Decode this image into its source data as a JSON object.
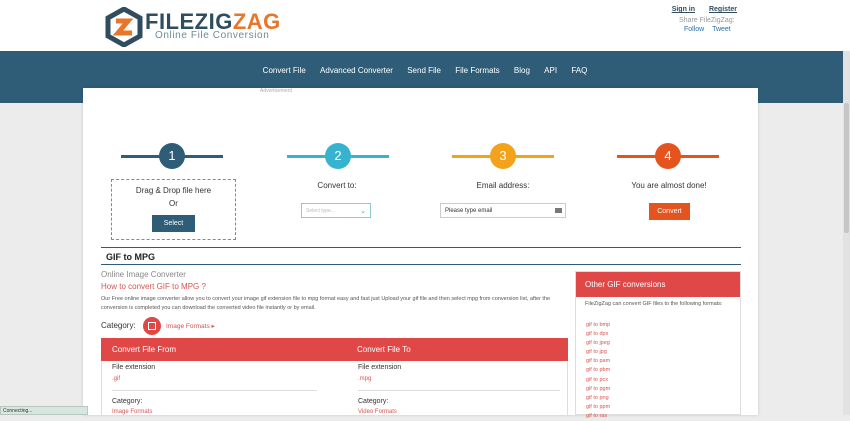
{
  "header": {
    "brand_main": "FILEZIG",
    "brand_accent": "ZAG",
    "tagline": "Online File Conversion",
    "sign_in": "Sign in",
    "register": "Register",
    "share_label": "Share FileZigZag:",
    "follow": "Follow",
    "tweet": "Tweet"
  },
  "nav": {
    "items": [
      "Convert File",
      "Advanced Converter",
      "Send File",
      "File Formats",
      "Blog",
      "API",
      "FAQ"
    ]
  },
  "advertisement_label": "Advertisement",
  "steps": [
    {
      "number": "1",
      "color": "#2f5d77"
    },
    {
      "number": "2",
      "color": "#36b3ce"
    },
    {
      "number": "3",
      "color": "#f2a31b"
    },
    {
      "number": "4",
      "color": "#e5541f"
    }
  ],
  "upload": {
    "line1": "Drag & Drop file here",
    "line2": "Or",
    "select_button": "Select"
  },
  "convert_to": {
    "label": "Convert to:",
    "placeholder": "Select type..."
  },
  "email": {
    "label": "Email address:",
    "placeholder": "Please type email"
  },
  "finish": {
    "label": "You are almost done!",
    "button": "Convert"
  },
  "section": {
    "title": "GIF to MPG",
    "subtitle": "Online Image Converter",
    "how_link": "How to convert GIF to MPG ?",
    "description": "Our Free online image converter allow you to convert your image gif extension file to mpg format easy and fast just Upload your gif file and then select mpg from conversion list, after the conversion is completed you can download the converted video file instantly or by email.",
    "category_label": "Category:",
    "category_link": "Image Formats ▸"
  },
  "table": {
    "col_from": "Convert File From",
    "col_to": "Convert File To",
    "ext_label": "File extension",
    "from_ext": ".gif",
    "to_ext": ".mpg",
    "category_label": "Category:",
    "from_category": "Image Formats",
    "to_category": "Video Formats"
  },
  "sidebar": {
    "title": "Other GIF conversions",
    "intro": "FileZigZag can convert GIF files to the following formats:",
    "links": [
      "gif to bmp",
      "gif to dpx",
      "gif to jpeg",
      "gif to jpg",
      "gif to pam",
      "gif to pbm",
      "gif to pcx",
      "gif to pgm",
      "gif to png",
      "gif to ppm",
      "gif to ras"
    ]
  },
  "status_bar": "Connecting...",
  "colors": {
    "navy": "#2f5d77",
    "red": "#e04848",
    "orange": "#e5541f"
  }
}
